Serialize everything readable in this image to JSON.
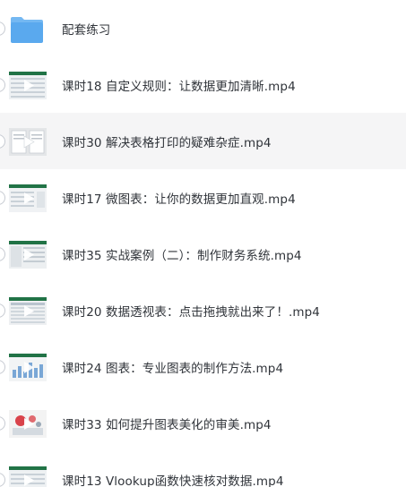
{
  "files": [
    {
      "name": "配套练习",
      "type": "folder",
      "icon": "folder-icon"
    },
    {
      "name": "课时18 自定义规则：让数据更加清晰.mp4",
      "type": "video",
      "icon": "video-thumbnail-icon"
    },
    {
      "name": "课时30 解决表格打印的疑难杂症.mp4",
      "type": "video",
      "icon": "video-thumbnail-icon",
      "selected": true
    },
    {
      "name": "课时17 微图表：让你的数据更加直观.mp4",
      "type": "video",
      "icon": "video-thumbnail-icon"
    },
    {
      "name": "课时35 实战案例（二）：制作财务系统.mp4",
      "type": "video",
      "icon": "video-thumbnail-icon"
    },
    {
      "name": "课时20 数据透视表：点击拖拽就出来了！.mp4",
      "type": "video",
      "icon": "video-thumbnail-icon"
    },
    {
      "name": "课时24 图表：专业图表的制作方法.mp4",
      "type": "video",
      "icon": "video-thumbnail-icon"
    },
    {
      "name": "课时33 如何提升图表美化的审美.mp4",
      "type": "video",
      "icon": "video-thumbnail-icon"
    },
    {
      "name": "课时13 Vlookup函数快速核对数据.mp4",
      "type": "video",
      "icon": "video-thumbnail-icon"
    }
  ],
  "colors": {
    "folder": "#5aa9ee",
    "folder_tab": "#74b8f2",
    "selected_row": "#f5f5f6",
    "text": "#30343a",
    "excel_green": "#217346"
  }
}
